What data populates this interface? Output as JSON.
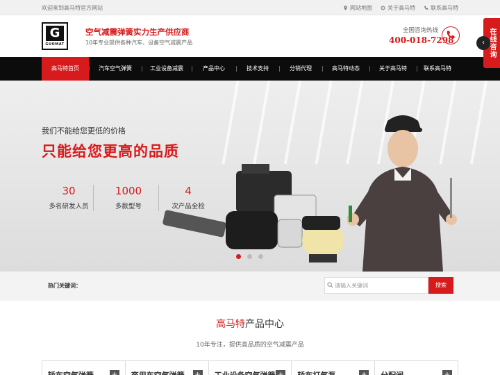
{
  "topbar": {
    "welcome": "欢迎来到高马特官方网站",
    "links": [
      "网站地图",
      "关于高马特",
      "联系高马特"
    ]
  },
  "header": {
    "logo_letter": "G",
    "logo_word": "GUOMAT",
    "slogan": "空气减震弹簧实力生产供应商",
    "subslogan": "10年专业提供各种汽车、设备空气减震产品",
    "hotline_label": "全国咨询热线",
    "hotline_number": "400-018-7298"
  },
  "nav": {
    "items": [
      "高马特首页",
      "汽车空气弹簧",
      "工业设备减震",
      "产品中心",
      "技术支持",
      "分销代理",
      "高马特动态",
      "关于高马特",
      "联系高马特"
    ]
  },
  "online": {
    "label": "在线咨询",
    "arrow": "‹"
  },
  "banner": {
    "line1": "我们不能给您更低的价格",
    "line2": "只能给您更高的品质",
    "stats": [
      {
        "num": "30",
        "label": "多名研发人员"
      },
      {
        "num": "1000",
        "label": "多款型号"
      },
      {
        "num": "4",
        "label": "次产品全检"
      }
    ]
  },
  "search": {
    "hot_label": "热门关键词：",
    "placeholder": "请输入关键词",
    "button": "搜索"
  },
  "products": {
    "title_highlight": "高马特",
    "title_rest": "产品中心",
    "subtitle": "10年专注，提供高品质的空气减震产品",
    "categories": [
      "轿车空气弹簧",
      "商用车空气弹簧",
      "工业设备空气弹簧",
      "轿车打气泵",
      "分配阀"
    ],
    "plus": "+"
  },
  "colors": {
    "brand_red": "#d71a1b",
    "nav_black": "#0c0c0c"
  }
}
